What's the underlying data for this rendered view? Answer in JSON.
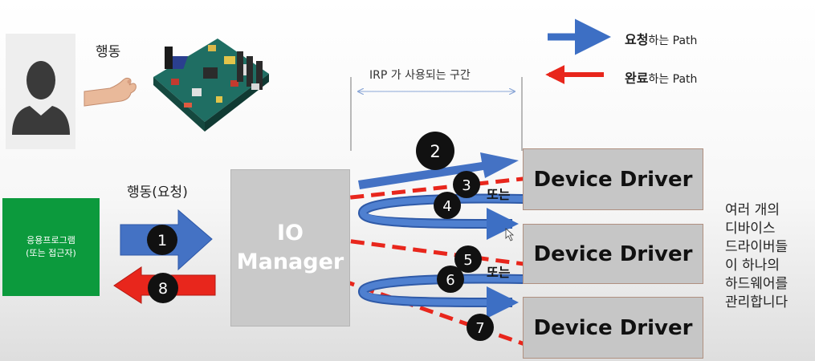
{
  "labels": {
    "action": "행동",
    "action_request": "행동(요청)",
    "app_line1": "응용프로그램",
    "app_line2": "(또는 접근자)",
    "io_line1": "IO",
    "io_line2": "Manager",
    "irp_section": "IRP 가 사용되는 구간",
    "or_1": "또는",
    "or_2": "또는"
  },
  "legend": {
    "request_bold": "요청",
    "request_rest": "하는 Path",
    "complete_bold": "완료",
    "complete_rest": "하는 Path"
  },
  "drivers": [
    "Device Driver",
    "Device Driver",
    "Device Driver"
  ],
  "steps": [
    "1",
    "2",
    "3",
    "4",
    "5",
    "6",
    "7",
    "8"
  ],
  "side_note": [
    "여러 개의",
    "디바이스",
    "드라이버들",
    "이 하나의",
    "하드웨어를",
    "관리합니다"
  ],
  "colors": {
    "request_arrow": "#3d6fc4",
    "complete_arrow": "#e8261c",
    "app_box": "#0c9a3d",
    "io_box": "#c9c9c9",
    "driver_box": "#c6c6c6",
    "step_badge": "#111111"
  },
  "icons": [
    "person-silhouette-icon",
    "hand-pinch-icon",
    "circuit-board-icon",
    "cursor-icon"
  ]
}
